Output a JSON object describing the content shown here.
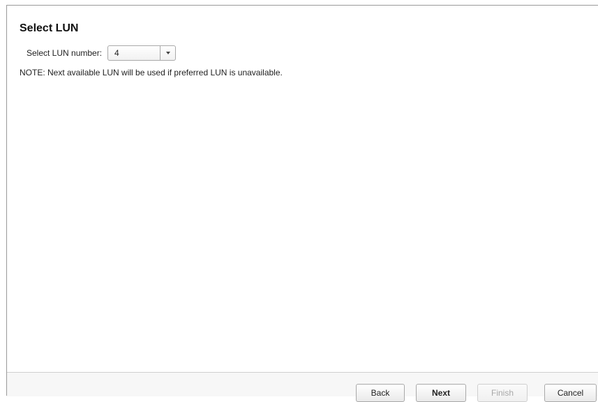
{
  "title": "Select LUN",
  "lun": {
    "label": "Select LUN number:",
    "selected": "4"
  },
  "note": "NOTE: Next available LUN will be used if preferred LUN is unavailable.",
  "buttons": {
    "back": "Back",
    "next": "Next",
    "finish": "Finish",
    "cancel": "Cancel"
  }
}
